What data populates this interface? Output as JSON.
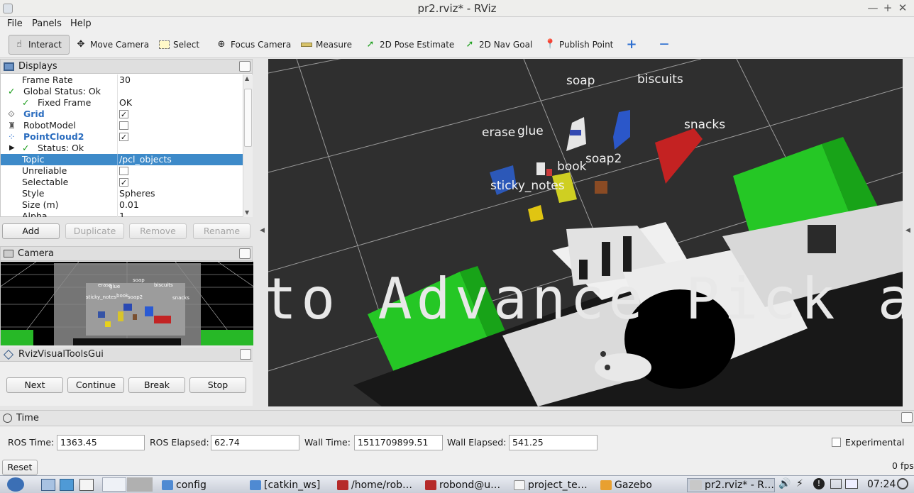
{
  "window": {
    "title": "pr2.rviz* - RViz",
    "min_glyph": "—",
    "max_glyph": "+",
    "close_glyph": "✕"
  },
  "menu": [
    "File",
    "Panels",
    "Help"
  ],
  "toolbar": {
    "interact": "Interact",
    "move_camera": "Move Camera",
    "select": "Select",
    "focus_camera": "Focus Camera",
    "measure": "Measure",
    "pose_estimate": "2D Pose Estimate",
    "nav_goal": "2D Nav Goal",
    "publish_point": "Publish Point",
    "plus": "+",
    "minus": "—"
  },
  "displays": {
    "title": "Displays",
    "rows": [
      {
        "name": "Frame Rate",
        "value": "30"
      },
      {
        "name": "Global Status: Ok",
        "value": ""
      },
      {
        "name": "Fixed Frame",
        "value": "OK"
      },
      {
        "name": "Grid",
        "value": "✓"
      },
      {
        "name": "RobotModel",
        "value": ""
      },
      {
        "name": "PointCloud2",
        "value": "✓"
      },
      {
        "name": "Status: Ok",
        "value": ""
      },
      {
        "name": "Topic",
        "value": "/pcl_objects"
      },
      {
        "name": "Unreliable",
        "value": ""
      },
      {
        "name": "Selectable",
        "value": "✓"
      },
      {
        "name": "Style",
        "value": "Spheres"
      },
      {
        "name": "Size (m)",
        "value": "0.01"
      },
      {
        "name": "Alpha",
        "value": "1"
      }
    ],
    "buttons": {
      "add": "Add",
      "duplicate": "Duplicate",
      "remove": "Remove",
      "rename": "Rename"
    }
  },
  "camera": {
    "title": "Camera",
    "labels": [
      "erase",
      "glue",
      "soap",
      "biscuits",
      "sticky_notes",
      "book",
      "soap2",
      "snacks"
    ]
  },
  "rviz_tools": {
    "title": "RvizVisualToolsGui",
    "next": "Next",
    "continue": "Continue",
    "break": "Break",
    "stop": "Stop"
  },
  "scene": {
    "labels": {
      "soap": "soap",
      "biscuits": "biscuits",
      "snacks": "snacks",
      "erase": "erase",
      "glue": "glue",
      "book": "book",
      "soap2": "soap2",
      "sticky_notes": "sticky_notes"
    },
    "banner": "to Advance Pick and P"
  },
  "time": {
    "title": "Time",
    "ros_time_label": "ROS Time:",
    "ros_time": "1363.45",
    "ros_elapsed_label": "ROS Elapsed:",
    "ros_elapsed": "62.74",
    "wall_time_label": "Wall Time:",
    "wall_time": "1511709899.51",
    "wall_elapsed_label": "Wall Elapsed:",
    "wall_elapsed": "541.25",
    "experimental": "Experimental",
    "reset": "Reset",
    "fps": "0 fps"
  },
  "taskbar": {
    "tasks": [
      "config",
      "[catkin_ws]",
      "/home/rob…",
      "robond@u…",
      "project_te…",
      "Gazebo",
      "pr2.rviz* - R…"
    ],
    "clock": "07:24"
  },
  "colors": {
    "selection": "#3d8ac9",
    "bin_green": "#2fd02f",
    "viewport_bg": "#2f2f2f"
  }
}
